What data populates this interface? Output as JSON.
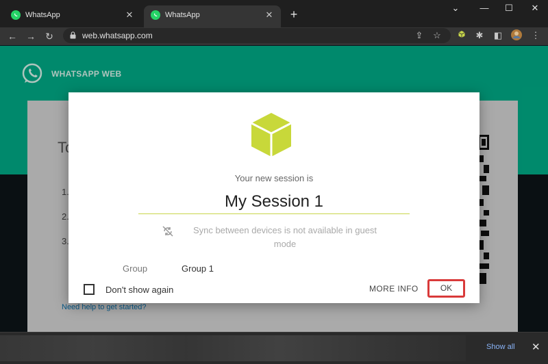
{
  "browser": {
    "tabs": [
      {
        "title": "WhatsApp",
        "close": "✕"
      },
      {
        "title": "WhatsApp",
        "close": "✕"
      }
    ],
    "new_tab": "+",
    "window": {
      "minimize": "⌄",
      "min2": "—",
      "maximize": "☐",
      "close": "✕"
    },
    "url": "web.whatsapp.com"
  },
  "page": {
    "brand_title": "WHATSAPP WEB",
    "heading_partial": "To",
    "steps": [
      "1.",
      "2.",
      "3."
    ],
    "help_link": "Need help to get started?"
  },
  "modal": {
    "session_label": "Your new session is",
    "session_value": "My Session 1",
    "sync_text": "Sync between devices is not available in guest mode",
    "group_label": "Group",
    "group_value": "Group 1",
    "dont_show_label": "Don't show again",
    "more_info": "MORE INFO",
    "ok": "OK",
    "accent_color": "#c8d64a",
    "highlight_color": "#d93a3a"
  },
  "download_bar": {
    "show_all": "Show all",
    "close": "✕"
  }
}
